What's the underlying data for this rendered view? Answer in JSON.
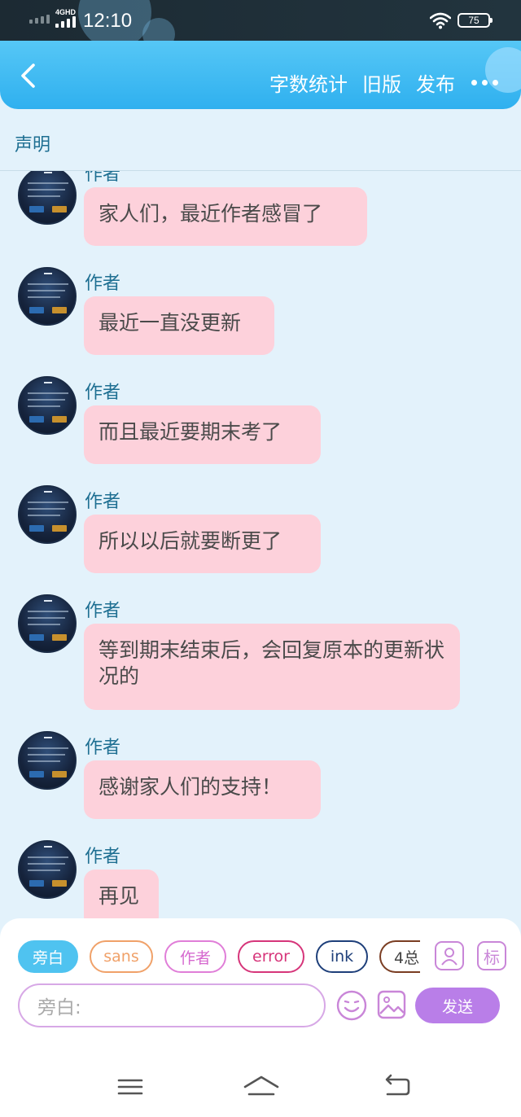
{
  "status_bar": {
    "network": "4GHD",
    "time": "12:10",
    "battery": "75"
  },
  "header": {
    "actions": {
      "word_count": "字数统计",
      "old_version": "旧版",
      "publish": "发布"
    }
  },
  "statement": {
    "label": "声明"
  },
  "messages": [
    {
      "sender": "作者",
      "text": "家人们，最近作者感冒了"
    },
    {
      "sender": "作者",
      "text": "最近一直没更新"
    },
    {
      "sender": "作者",
      "text": "而且最近要期末考了"
    },
    {
      "sender": "作者",
      "text": "所以以后就要断更了"
    },
    {
      "sender": "作者",
      "text": "等到期末结束后，会回复原本的更新状况的"
    },
    {
      "sender": "作者",
      "text": "感谢家人们的支持！"
    },
    {
      "sender": "作者",
      "text": "再见"
    }
  ],
  "composer": {
    "chips": {
      "narration": "旁白",
      "sans": "sans",
      "author": "作者",
      "error": "error",
      "ink": "ink",
      "more": "4总"
    },
    "tag_icon_label": "标",
    "input_placeholder": "旁白:",
    "send_label": "发送"
  },
  "colors": {
    "header": "#3bb8f1",
    "bubble": "#fdd1db",
    "background": "#e3f2fb",
    "send_button": "#b97ee8"
  }
}
